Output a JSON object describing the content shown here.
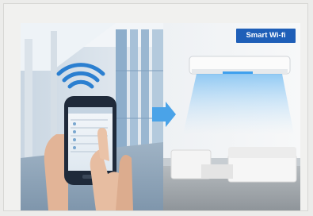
{
  "badge": {
    "label": "Smart Wi-fi"
  },
  "icons": [
    "wifi-signal-icon",
    "arrow-right-icon"
  ],
  "colors": {
    "badge_bg": "#1f5fb8",
    "badge_text": "#ffffff",
    "arrow": "#4aa3e8",
    "wifi": "#2b7fd0"
  }
}
